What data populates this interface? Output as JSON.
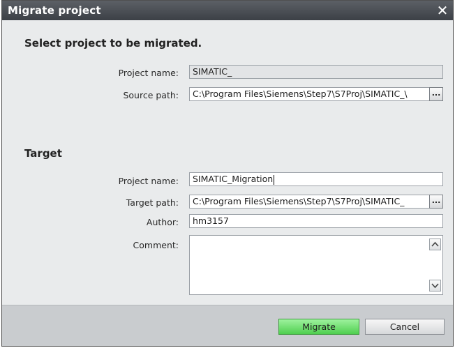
{
  "window": {
    "title": "Migrate project",
    "close_icon": "close-icon"
  },
  "source": {
    "heading": "Select project to be migrated.",
    "project_name_label": "Project name:",
    "project_name_value": "SIMATIC_",
    "source_path_label": "Source path:",
    "source_path_value": "C:\\Program Files\\Siemens\\Step7\\S7Proj\\SIMATIC_\\",
    "browse_label": "..."
  },
  "target": {
    "heading": "Target",
    "project_name_label": "Project name:",
    "project_name_value": "SIMATIC_Migration",
    "target_path_label": "Target path:",
    "target_path_value": "C:\\Program Files\\Siemens\\Step7\\S7Proj\\SIMATIC_",
    "browse_label": "...",
    "author_label": "Author:",
    "author_value": "hm3157",
    "comment_label": "Comment:",
    "comment_value": ""
  },
  "buttons": {
    "migrate": "Migrate",
    "cancel": "Cancel"
  },
  "colors": {
    "titlebar": "#4a4e54",
    "migrate_button": "#6fdc6f",
    "dialog_bg": "#e9ebec",
    "footer_bg": "#c9cccf"
  }
}
